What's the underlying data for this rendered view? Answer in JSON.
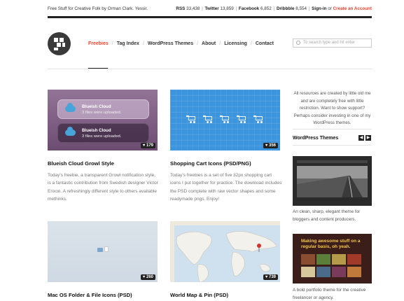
{
  "topbar": {
    "tagline": "Free Stuff for Creative Folk by Orman Clark. Yessir.",
    "rss_label": "RSS",
    "rss_count": "33,438",
    "twitter_label": "Twitter",
    "twitter_count": "13,859",
    "facebook_label": "Facebook",
    "facebook_count": "6,852",
    "dribbble_label": "Dribbble",
    "dribbble_count": "8,554",
    "sign_in": "Sign-in",
    "or": "or",
    "create_account": "Create an Account"
  },
  "nav": {
    "items": [
      "Freebies",
      "Tag Index",
      "WordPress Themes",
      "About",
      "Licensing",
      "Contact"
    ],
    "active_color": "#e8412c"
  },
  "search": {
    "placeholder": "To search type and hit enter"
  },
  "cards": [
    {
      "title": "Blueish Cloud Growl Style",
      "likes": "179",
      "description": "Today's freebie, a transparent Growl notification style, is a fantastic contribution from Swedish designer Victor Erixon. A refreshingly different style to others available methinks.",
      "growls": [
        {
          "title": "Blueish Cloud",
          "subtitle": "3 files were uploaded."
        },
        {
          "title": "Blueish Cloud",
          "subtitle": "3 files were uploaded."
        }
      ]
    },
    {
      "title": "Shopping Cart Icons (PSD/PNG)",
      "likes": "356",
      "description": "Today's freebies is a set of five 32px shopping cart icons I put together for practice. The download includes the PSD complete with raw vector shapes and some readymade pngs. Enjoy!"
    },
    {
      "title": "Mac OS Folder & File Icons (PSD)",
      "likes": "260"
    },
    {
      "title": "World Map & Pin (PSD)",
      "likes": "739"
    }
  ],
  "sidebar": {
    "intro": "All resources are created by little old me and are completely free with little restriction. Want to show support? Perhaps consider investing in one of my WordPress themes.",
    "themes_title": "WordPress Themes",
    "themes": [
      {
        "description": "An clean, sharp, elegant theme for bloggers and content producers."
      },
      {
        "headline": "Making awesome stuff on a regular basis, oh yeah.",
        "description": "A bold portfolio theme for the creative freelancer or agency."
      }
    ]
  },
  "colors": {
    "accent": "#e8412c",
    "dark": "#222222",
    "cart_blue": "#3d95de",
    "growl_purple": "#7d5e82"
  }
}
